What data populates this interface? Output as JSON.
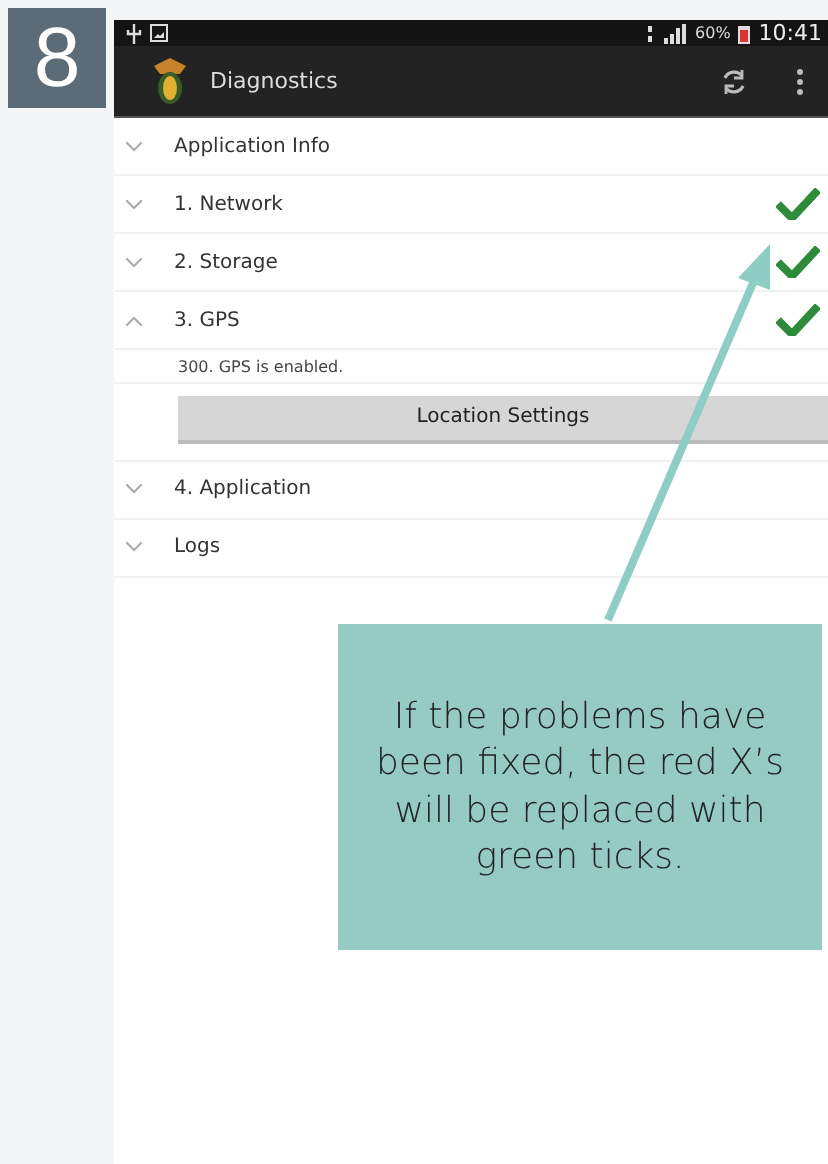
{
  "step": "8",
  "status_bar": {
    "battery": "60%",
    "time": "10:41"
  },
  "action_bar": {
    "title": "Diagnostics"
  },
  "sections": [
    {
      "label": "Application Info",
      "expanded": false,
      "passed": false
    },
    {
      "label": "1. Network",
      "expanded": false,
      "passed": true
    },
    {
      "label": "2. Storage",
      "expanded": false,
      "passed": true
    },
    {
      "label": "3. GPS",
      "expanded": true,
      "passed": true,
      "detail": "300. GPS is enabled.",
      "button": "Location Settings"
    },
    {
      "label": "4. Application",
      "expanded": false,
      "passed": false
    },
    {
      "label": "Logs",
      "expanded": false,
      "passed": false
    }
  ],
  "callout": {
    "text": "If the problems have been fixed, the red X’s will be replaced with green ticks."
  }
}
